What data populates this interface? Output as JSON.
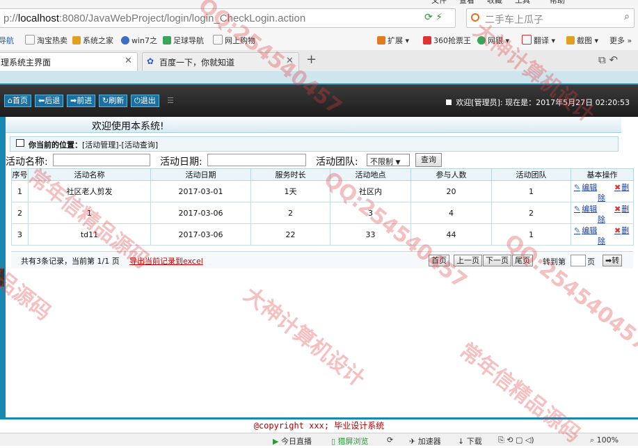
{
  "browser": {
    "menu": [
      "文件",
      "查看",
      "收藏",
      "工具",
      "帮助"
    ],
    "url_prefix": "p://",
    "url_host": "localhost",
    "url_rest": ":8080/JavaWebProject/login/login_CheckLogin.action",
    "search_placeholder": "二手车上瓜子",
    "bookmarks": [
      "导航",
      "淘宝热卖",
      "系统之家",
      "win7之",
      "足球导航",
      "网上购物"
    ],
    "bookmarks_right": [
      "扩展",
      "360抢票王",
      "网银",
      "翻译",
      "截图",
      "更多"
    ],
    "tabs": [
      {
        "title": "理系统主界面"
      },
      {
        "title": "百度一下，你就知道"
      }
    ]
  },
  "app": {
    "nav": [
      "首页",
      "后退",
      "前进",
      "刷新",
      "退出"
    ],
    "welcome_top": "欢迎[管理员]:  现在是：2017年5月27日 02:20:53",
    "welcome_banner": "欢迎使用本系统!",
    "location_label": "你当前的位置：",
    "location_path": "[活动管理]-[活动查询]",
    "filters": {
      "name_label": "活动名称:",
      "date_label": "活动日期:",
      "team_label": "活动团队:",
      "team_value": "不限制",
      "query_button": "查询"
    },
    "table": {
      "headers": [
        "序号",
        "活动名称",
        "活动日期",
        "服务时长",
        "活动地点",
        "参与人数",
        "活动团队",
        "基本操作"
      ],
      "rows": [
        [
          "1",
          "社区老人剪发",
          "2017-03-01",
          "1天",
          "社区内",
          "20",
          "1"
        ],
        [
          "2",
          "1",
          "2017-03-06",
          "2",
          "3",
          "4",
          "2"
        ],
        [
          "3",
          "td11",
          "2017-03-06",
          "22",
          "33",
          "44",
          "1"
        ]
      ],
      "edit_label": "编辑",
      "delete_label_a": "删",
      "delete_label_b": "除"
    },
    "summary": "共有3条记录，当前第 1/1 页",
    "export_link": "导出当前记录到excel",
    "pager": {
      "first": "首页",
      "prev": "上一页",
      "next": "下一页",
      "last": "尾页",
      "goto_label": "转到第",
      "page_unit": "页",
      "go_button": "转"
    },
    "copyright": "@copyright xxx; 毕业设计系统"
  },
  "statusbar": [
    "今日直播",
    "猎屏浏览",
    "加速器",
    "下载",
    "100%"
  ],
  "watermarks": [
    "QQ:254540457",
    "大神计算机设计",
    "常年信精品源码",
    "QQ:254540457",
    "精品源码",
    "大神计算机设计",
    "QQ:254540457",
    "常年信精品源码"
  ]
}
